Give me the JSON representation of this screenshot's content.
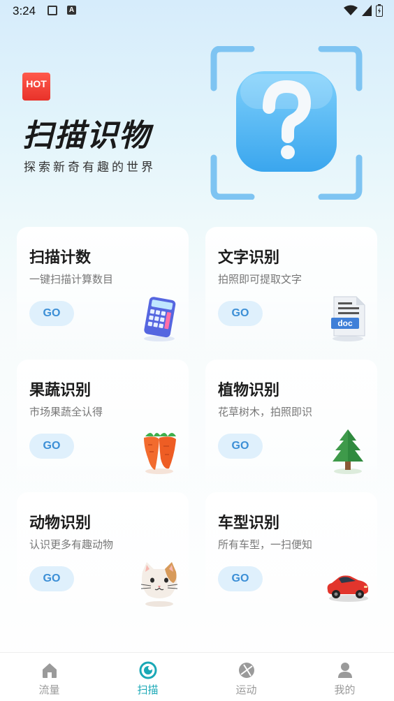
{
  "status_bar": {
    "time": "3:24",
    "icons": [
      "notification-icon",
      "a-icon",
      "wifi-icon",
      "signal-icon",
      "battery-icon"
    ]
  },
  "hero": {
    "badge": "HOT",
    "title": "扫描识物",
    "subtitle": "探索新奇有趣的世界",
    "illustration": "question-scan-icon"
  },
  "features": [
    {
      "title": "扫描计数",
      "desc": "一键扫描计算数目",
      "button": "GO",
      "icon": "calculator-icon"
    },
    {
      "title": "文字识别",
      "desc": "拍照即可提取文字",
      "button": "GO",
      "icon": "doc-file-icon"
    },
    {
      "title": "果蔬识别",
      "desc": "市场果蔬全认得",
      "button": "GO",
      "icon": "carrot-icon"
    },
    {
      "title": "植物识别",
      "desc": "花草树木，拍照即识",
      "button": "GO",
      "icon": "tree-icon"
    },
    {
      "title": "动物识别",
      "desc": "认识更多有趣动物",
      "button": "GO",
      "icon": "cat-icon"
    },
    {
      "title": "车型识别",
      "desc": "所有车型，一扫便知",
      "button": "GO",
      "icon": "car-icon"
    }
  ],
  "bottom_nav": [
    {
      "label": "流量",
      "icon": "home-icon",
      "active": false
    },
    {
      "label": "扫描",
      "icon": "scan-icon",
      "active": true
    },
    {
      "label": "运动",
      "icon": "ball-icon",
      "active": false
    },
    {
      "label": "我的",
      "icon": "user-icon",
      "active": false
    }
  ],
  "colors": {
    "accent": "#1aa8b6",
    "go_button_bg": "#dff0fc",
    "go_button_text": "#3c8fd6",
    "hot_badge": "#e8322a"
  }
}
